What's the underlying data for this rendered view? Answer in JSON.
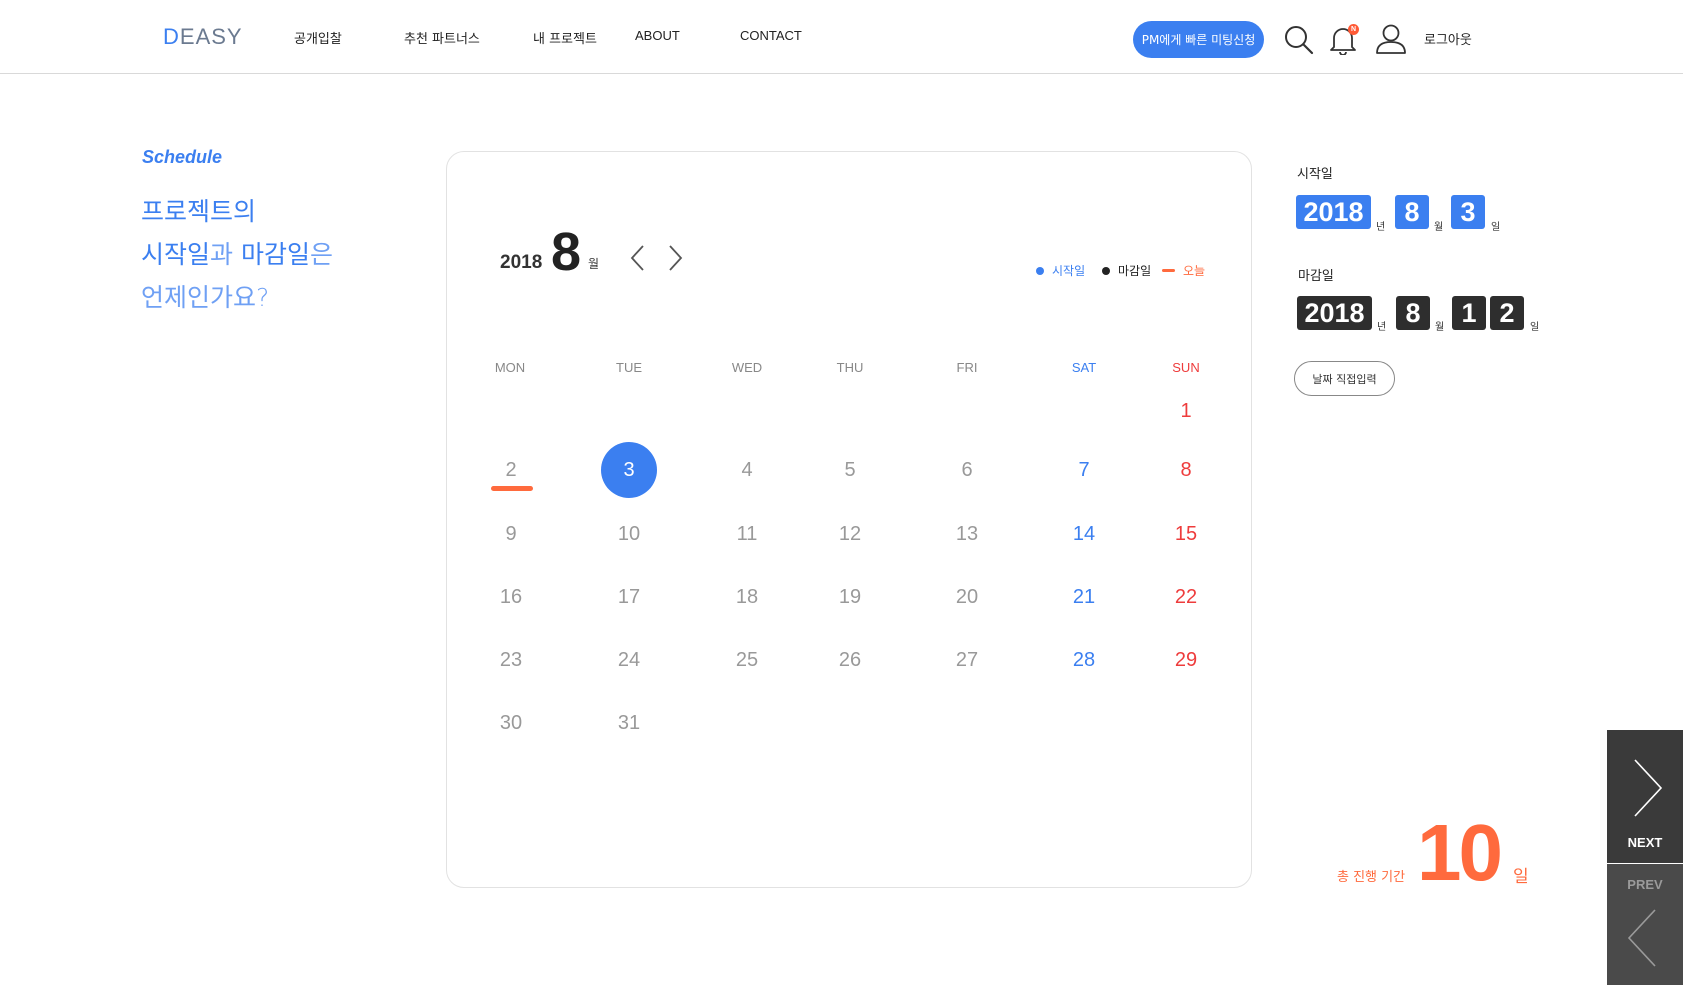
{
  "header": {
    "logo": {
      "first": "D",
      "rest": "EASY"
    },
    "nav": [
      "공개입찰",
      "추천 파트너스",
      "내 프로젝트",
      "ABOUT",
      "CONTACT"
    ],
    "meeting_button": "PM에게 빠른 미팅신청",
    "notification_badge": "N",
    "logout": "로그아웃"
  },
  "intro": {
    "label": "Schedule",
    "line1": "프로젝트의",
    "line2_a": "시작일",
    "line2_b": "과 ",
    "line2_c": "마감일",
    "line2_d": "은",
    "line3": "언제인가요?"
  },
  "calendar": {
    "year": "2018",
    "month": "8",
    "month_unit": "월",
    "legend": [
      {
        "label": "시작일",
        "color": "#3b7ff0",
        "kind": "dot"
      },
      {
        "label": "마감일",
        "color": "#222222",
        "kind": "dot"
      },
      {
        "label": "오늘",
        "color": "#ff6a3d",
        "kind": "bar"
      }
    ],
    "weekdays": [
      "MON",
      "TUE",
      "WED",
      "THU",
      "FRI",
      "SAT",
      "SUN"
    ],
    "weeks": [
      [
        "",
        "",
        "",
        "",
        "",
        "",
        "1"
      ],
      [
        "2",
        "3",
        "4",
        "5",
        "6",
        "7",
        "8"
      ],
      [
        "9",
        "10",
        "11",
        "12",
        "13",
        "14",
        "15"
      ],
      [
        "16",
        "17",
        "18",
        "19",
        "20",
        "21",
        "22"
      ],
      [
        "23",
        "24",
        "25",
        "26",
        "27",
        "28",
        "29"
      ],
      [
        "30",
        "31",
        "",
        "",
        "",
        "",
        ""
      ]
    ],
    "start_day": "3",
    "today": "2"
  },
  "start_date": {
    "label": "시작일",
    "year": "2018",
    "year_unit": "년",
    "month": "8",
    "month_unit": "월",
    "day": "3",
    "day_unit": "일"
  },
  "end_date": {
    "label": "마감일",
    "year": "2018",
    "year_unit": "년",
    "month": "8",
    "month_unit": "월",
    "day_1": "1",
    "day_2": "2",
    "day_unit": "일"
  },
  "direct_input_button": "날짜 직접입력",
  "total": {
    "label": "총 진행 기간",
    "value": "10",
    "unit": "일"
  },
  "pager": {
    "next": "NEXT",
    "prev": "PREV"
  },
  "colors": {
    "accent": "#3b7ff0",
    "today": "#ff6a3d",
    "sunday": "#ee3c3c",
    "dark": "#2e2e2e"
  }
}
